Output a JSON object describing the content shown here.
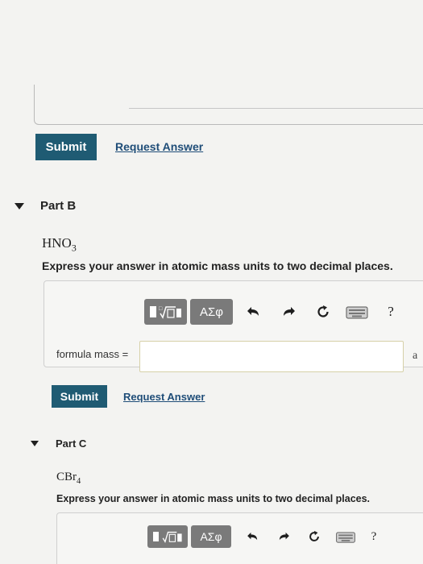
{
  "part_a": {
    "submit_label": "Submit",
    "request_label": "Request Answer"
  },
  "part_b": {
    "title": "Part B",
    "formula_main": "HNO",
    "formula_sub": "3",
    "instruction": "Express your answer in atomic mass units to two decimal places.",
    "toolbar": {
      "symbols_label": "ΑΣφ",
      "help_label": "?"
    },
    "field_label": "formula mass =",
    "field_value": "",
    "unit_partial": "a",
    "submit_label": "Submit",
    "request_label": "Request Answer"
  },
  "part_c": {
    "title": "Part C",
    "formula_main": "CBr",
    "formula_sub": "4",
    "instruction": "Express your answer in atomic mass units to two decimal places.",
    "toolbar": {
      "symbols_label": "ΑΣφ",
      "help_label": "?"
    }
  },
  "colors": {
    "submit_bg": "#1f5b73",
    "link": "#1f4d78",
    "toolbar_group": "#7a7a7a",
    "input_border": "#d6d0a8"
  },
  "icons": [
    "templates-icon",
    "greek-symbols-icon",
    "undo-icon",
    "redo-icon",
    "reset-icon",
    "keyboard-icon",
    "help-icon",
    "caret-down-icon"
  ]
}
